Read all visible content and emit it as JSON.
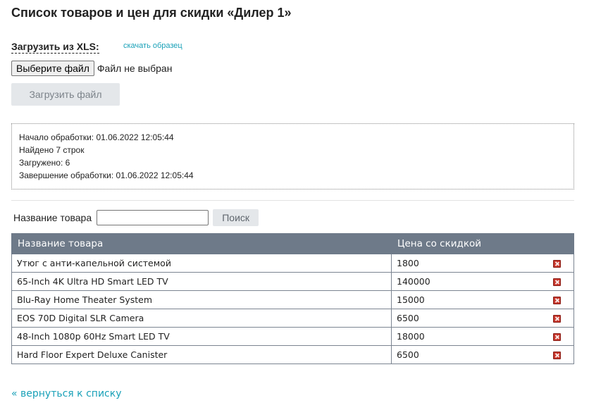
{
  "page": {
    "title": "Список товаров и цен для скидки «Дилер 1»"
  },
  "upload": {
    "xls_label": "Загрузить из XLS:",
    "sample_link": "скачать образец",
    "choose_file_button": "Выберите файл",
    "file_status": "Файл не выбран",
    "upload_button": "Загрузить файл"
  },
  "log": {
    "lines": [
      "Начало обработки: 01.06.2022 12:05:44",
      "Найдено 7 строк",
      "Загружено: 6",
      "Завершение обработки: 01.06.2022 12:05:44"
    ]
  },
  "search": {
    "label": "Название товара",
    "value": "",
    "button": "Поиск"
  },
  "table": {
    "columns": [
      "Название товара",
      "Цена со скидкой",
      ""
    ],
    "rows": [
      {
        "name": "Утюг с анти-капельной системой",
        "price": "1800",
        "action_icon": "delete-icon"
      },
      {
        "name": "65-Inch 4K Ultra HD Smart LED TV",
        "price": "140000",
        "action_icon": "delete-icon"
      },
      {
        "name": "Blu-Ray Home Theater System",
        "price": "15000",
        "action_icon": "delete-icon"
      },
      {
        "name": "EOS 70D Digital SLR Camera",
        "price": "6500",
        "action_icon": "delete-icon"
      },
      {
        "name": "48-Inch 1080p 60Hz Smart LED TV",
        "price": "18000",
        "action_icon": "delete-icon"
      },
      {
        "name": "Hard Floor Expert Deluxe Canister",
        "price": "6500",
        "action_icon": "delete-icon"
      }
    ]
  },
  "footer": {
    "back_link": "« вернуться к списку"
  },
  "colors": {
    "header_bg": "#6e7a89",
    "link": "#1aa1b8",
    "delete_icon": "#c6362b",
    "button_bg": "#e4e7ea"
  }
}
